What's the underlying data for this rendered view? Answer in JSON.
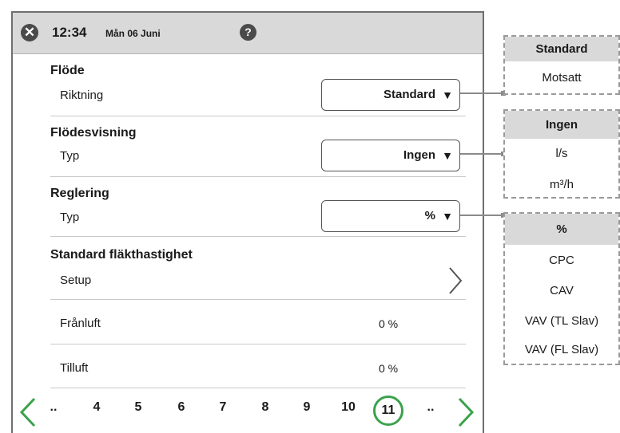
{
  "header": {
    "time": "12:34",
    "date": "Mån 06 Juni"
  },
  "sections": [
    {
      "title": "Flöde",
      "label": "Riktning",
      "dropdown": "Standard"
    },
    {
      "title": "Flödesvisning",
      "label": "Typ",
      "dropdown": "Ingen"
    },
    {
      "title": "Reglering",
      "label": "Typ",
      "dropdown": "%"
    },
    {
      "title": "Standard fläkthastighet",
      "label": "Setup"
    }
  ],
  "rows": [
    {
      "label": "Frånluft",
      "value": "0 %"
    },
    {
      "label": "Tilluft",
      "value": "0 %"
    }
  ],
  "pager": {
    "items": [
      "..",
      "4",
      "5",
      "6",
      "7",
      "8",
      "9",
      "10",
      "11",
      ".."
    ],
    "active": "11"
  },
  "popups": [
    {
      "header": "Standard",
      "options": [
        "Motsatt"
      ]
    },
    {
      "header": "Ingen",
      "options": [
        "l/s",
        "m³/h"
      ]
    },
    {
      "header": "%",
      "options": [
        "CPC",
        "CAV",
        "VAV (TL Slav)",
        "VAV (FL Slav)"
      ]
    }
  ],
  "colors": {
    "accent": "#3aa24b",
    "header_bg": "#d9d9d9"
  }
}
